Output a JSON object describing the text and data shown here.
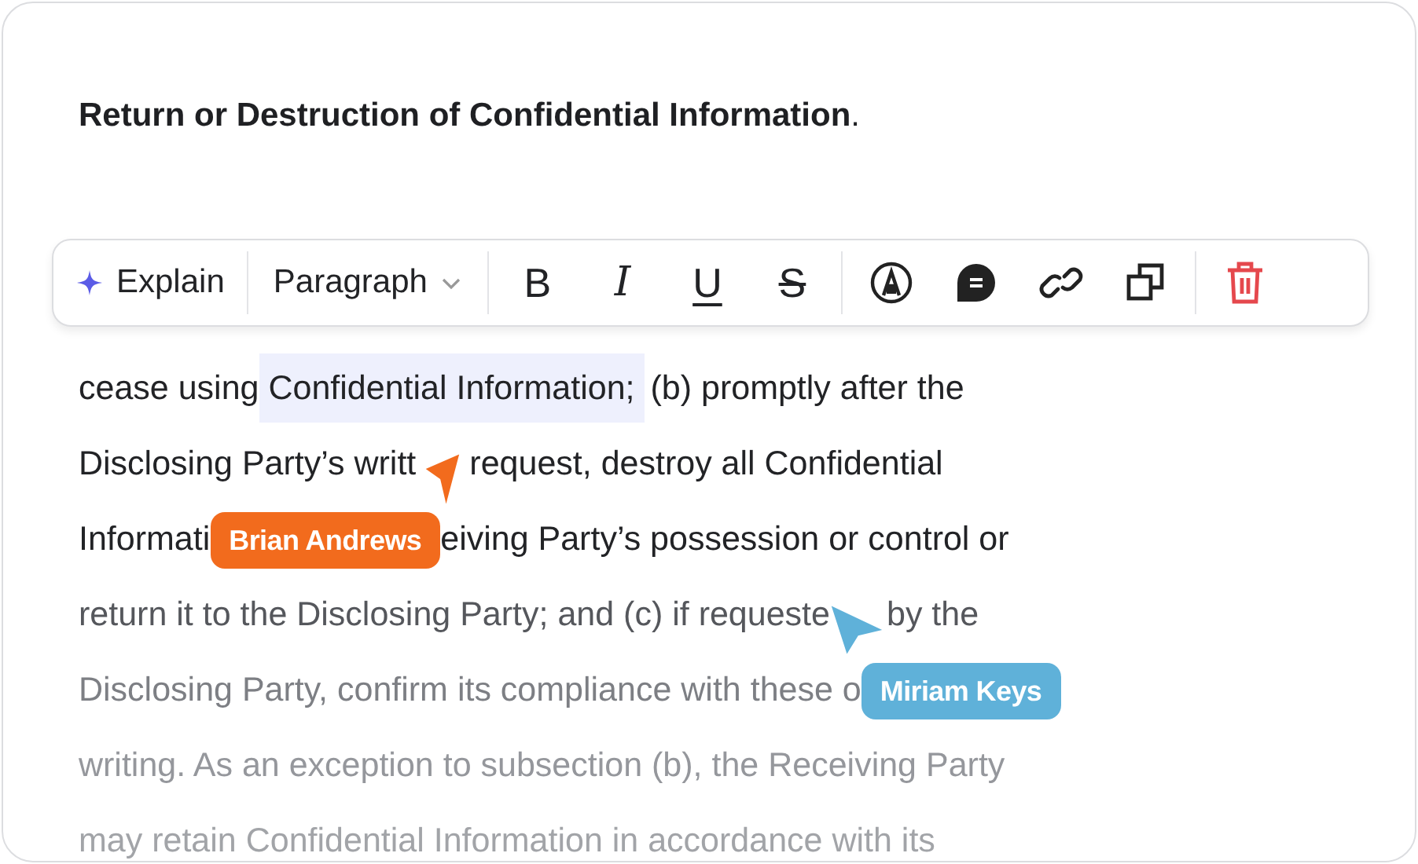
{
  "heading": "**Return or Destruction of Confidential Information**.",
  "toolbar": {
    "ai_action": {
      "label": "Explain"
    },
    "block_type": {
      "label": "Paragraph"
    },
    "format_buttons": [
      {
        "kind": "bold",
        "label": "B"
      },
      {
        "kind": "italic",
        "label": "I"
      },
      {
        "kind": "underline",
        "label": "U"
      },
      {
        "kind": "strike",
        "label": "S"
      }
    ],
    "tool_buttons": [
      {
        "kind": "mention"
      },
      {
        "kind": "comment"
      },
      {
        "kind": "link"
      },
      {
        "kind": "duplicate"
      }
    ],
    "danger_button": {
      "kind": "delete"
    }
  },
  "lines_after_toolbar": [
    {
      "parts": [
        {
          "kind": "text",
          "text": "cease using "
        },
        {
          "kind": "highlight",
          "text": "Confidential Information;"
        },
        {
          "kind": "text",
          "text": " (b) promptly after the"
        }
      ]
    },
    {
      "parts": [
        {
          "kind": "text",
          "text": "Disclosing Party’s writt"
        },
        {
          "kind": "cursor",
          "color": "#f26b1d"
        },
        {
          "kind": "text",
          "text": "request, destroy all Confidential"
        }
      ]
    },
    {
      "parts": [
        {
          "kind": "text",
          "text": "Informati"
        },
        {
          "kind": "collaborator",
          "name": "Brian Andrews",
          "color": "#f26b1d"
        },
        {
          "kind": "text",
          "text": "eiving Party’s possession or control or"
        }
      ]
    },
    {
      "parts": [
        {
          "kind": "text",
          "text": "return it to the Disclosing Party; and (c) if requeste"
        },
        {
          "kind": "pointer",
          "color": "#5fb1d9"
        },
        {
          "kind": "text",
          "text": "by the"
        }
      ]
    },
    {
      "parts": [
        {
          "kind": "text",
          "text": "Disclosing Party, confirm its compliance with these o"
        },
        {
          "kind": "collaborator",
          "name": "Miriam Keys",
          "color": "#5fb1d9"
        }
      ]
    },
    {
      "parts": [
        {
          "kind": "text",
          "text": "writing. As an exception to subsection (b), the Receiving Party"
        }
      ]
    },
    {
      "parts": [
        {
          "kind": "text",
          "text": "may retain Confidential Information in accordance with its"
        }
      ]
    }
  ]
}
